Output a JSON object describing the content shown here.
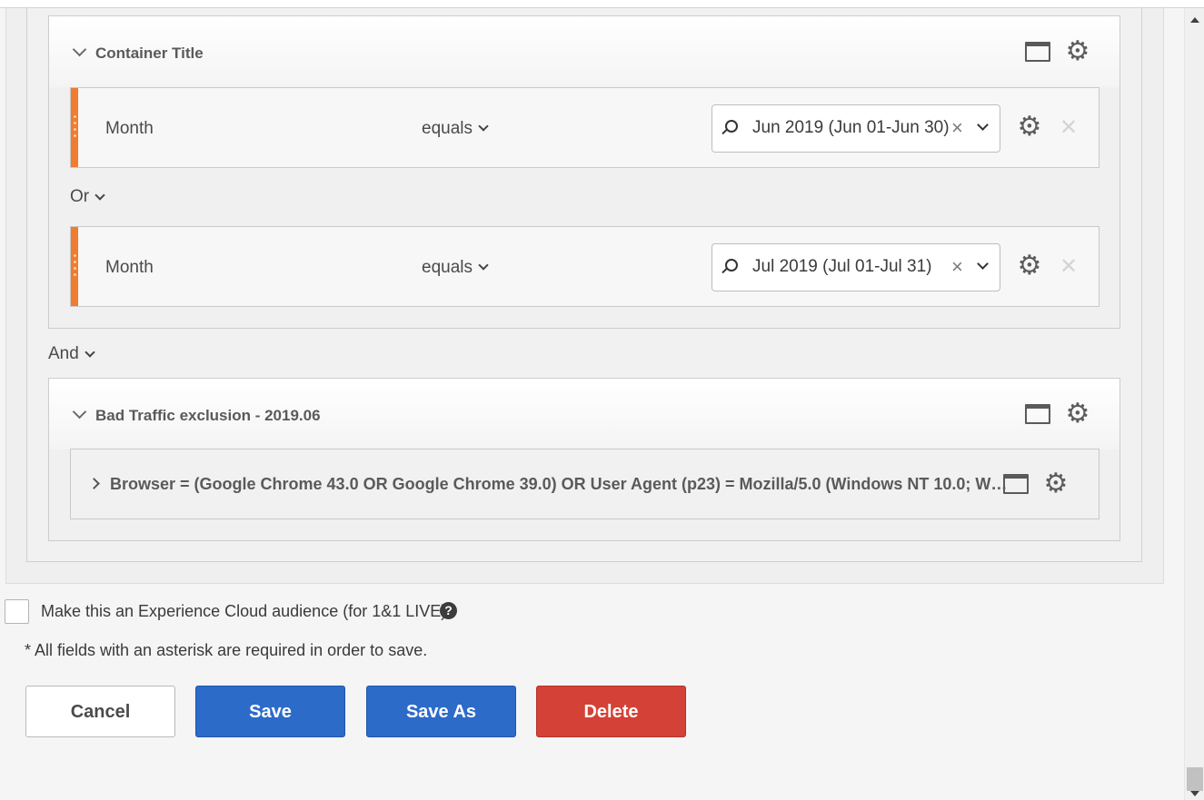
{
  "container1": {
    "title": "Container Title",
    "rows": [
      {
        "label": "Month",
        "operator": "equals",
        "value": "Jun 2019 (Jun 01-Jun 30)"
      },
      {
        "label": "Month",
        "operator": "equals",
        "value": "Jul 2019 (Jul 01-Jul 31)"
      }
    ],
    "inner_logic": "Or"
  },
  "outer_logic": "And",
  "container2": {
    "title": "Bad Traffic exclusion - 2019.06",
    "nested_row_text": "Browser = (Google Chrome 43.0 OR Google Chrome 39.0) OR User Agent (p23) = Mozilla/5.0 (Windows NT 10.0; W…"
  },
  "footer": {
    "checkbox_label": "Make this an Experience Cloud audience (for 1&1 LIVE)",
    "checkbox_checked": false,
    "help_glyph": "?",
    "required_note": "* All fields with an asterisk are required in order to save.",
    "buttons": {
      "cancel": "Cancel",
      "save": "Save",
      "save_as": "Save As",
      "delete": "Delete"
    }
  },
  "icons": {
    "clear": "×",
    "row_remove": "✕",
    "gear": "⚙"
  },
  "colors": {
    "accent_bar": "#f07c2f",
    "primary": "#2d6bc9",
    "danger": "#d44136"
  }
}
